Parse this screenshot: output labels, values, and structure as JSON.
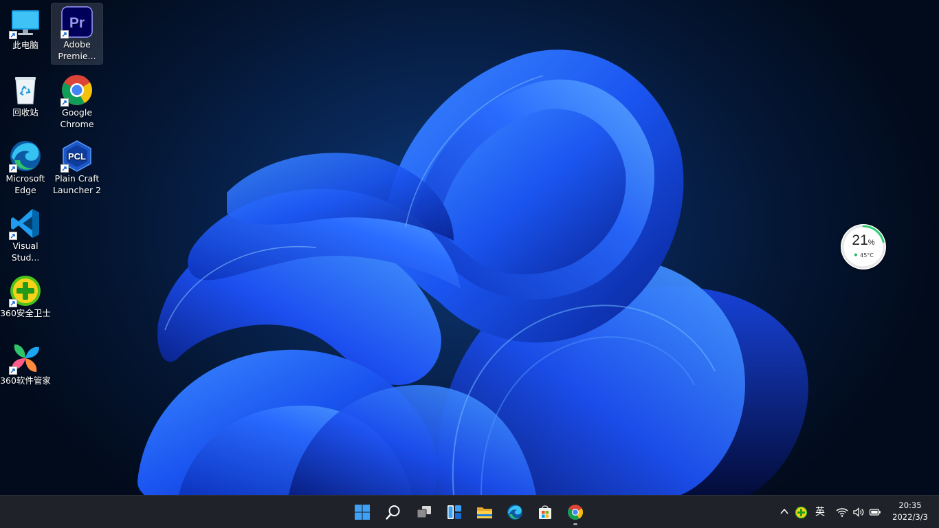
{
  "desktop": {
    "icons": [
      {
        "id": "this-pc",
        "label": "此电脑"
      },
      {
        "id": "premiere",
        "label": "Adobe\nPremie...",
        "selected": true
      },
      {
        "id": "recycle-bin",
        "label": "回收站"
      },
      {
        "id": "chrome",
        "label": "Google\nChrome"
      },
      {
        "id": "edge",
        "label": "Microsoft\nEdge"
      },
      {
        "id": "pcl",
        "label": "Plain Craft\nLauncher 2"
      },
      {
        "id": "vscode",
        "label": "Visual\nStud..."
      },
      {
        "id": "360-safe",
        "label": "360安全卫士"
      },
      {
        "id": "360-soft",
        "label": "360软件管家"
      }
    ],
    "icon_text": {
      "premiere": "Pr",
      "pcl": "PCL"
    }
  },
  "monitor_widget": {
    "usage_value": "21",
    "usage_unit": "%",
    "usage_fraction": 0.21,
    "temperature": "45°C",
    "ring_color": "#2ecc71"
  },
  "taskbar": {
    "buttons": [
      "start",
      "search",
      "task-view",
      "widgets",
      "file-explorer",
      "edge",
      "microsoft-store",
      "chrome"
    ],
    "tray": {
      "input_method": "英"
    },
    "clock": {
      "time": "20:35",
      "date": "2022/3/3"
    }
  },
  "colors": {
    "taskbar_bg": "#1f2228",
    "wallpaper_accent": "#1a5cff",
    "win_blue": "#3ea1f5"
  }
}
